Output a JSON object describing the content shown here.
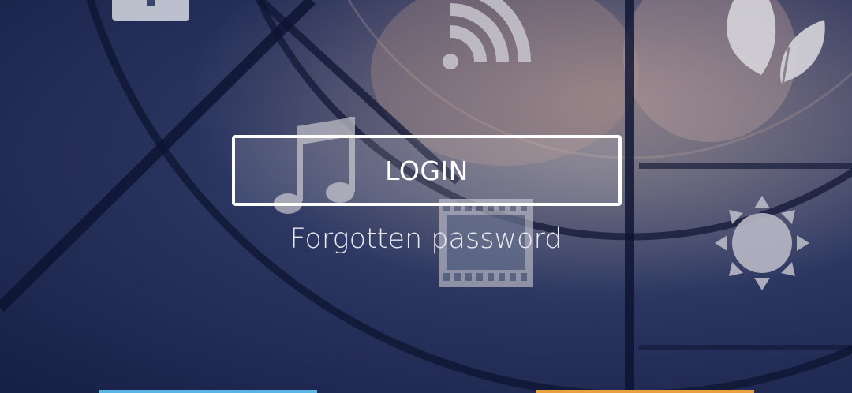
{
  "login": {
    "button_label": "LOGIN",
    "forgot_password_label": "Forgotten password"
  },
  "background": {
    "icons": [
      "lock-icon",
      "wifi-icon",
      "leaf-icon",
      "music-note-icon",
      "film-icon",
      "sun-icon"
    ]
  },
  "colors": {
    "bg_dark": "#1c2750",
    "button_border": "#ffffff",
    "text": "#ffffff",
    "bar_left": "#5ab4e6",
    "bar_right": "#e8a040"
  }
}
